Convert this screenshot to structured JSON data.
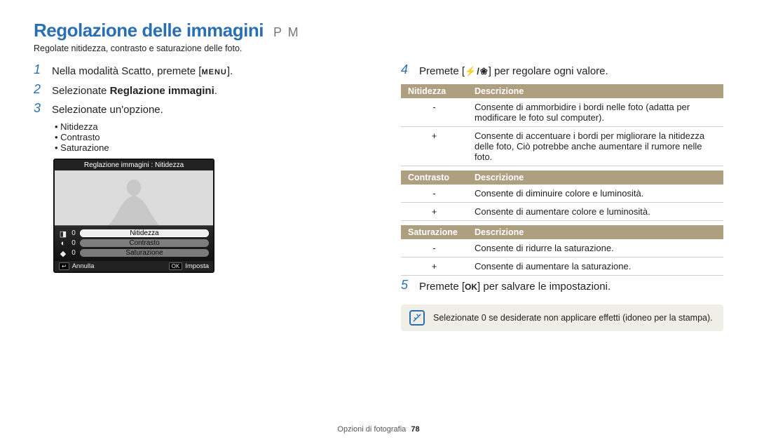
{
  "title": "Regolazione delle immagini",
  "mode_badges": "P M",
  "intro": "Regolate nitidezza, contrasto e saturazione delle foto.",
  "left": {
    "steps": {
      "1": {
        "pre": "Nella modalità Scatto, premete [",
        "icon": "MENU",
        "post": "]."
      },
      "2": {
        "pre": "Selezionate ",
        "bold": "Reglazione immagini",
        "post": "."
      },
      "3": {
        "text": "Selezionate un'opzione.",
        "bullets": [
          "Nitidezza",
          "Contrasto",
          "Saturazione"
        ]
      }
    },
    "camera": {
      "heading": "Reglazione immagini : Nitidezza",
      "rows": [
        {
          "icon": "◨",
          "value": "0",
          "label": "Nitidezza",
          "active": true
        },
        {
          "icon": "◐",
          "value": "0",
          "label": "Contrasto",
          "active": false
        },
        {
          "icon": "◆",
          "value": "0",
          "label": "Saturazione",
          "active": false
        }
      ],
      "back_key": "↩",
      "back_label": "Annulla",
      "ok_key": "OK",
      "ok_label": "Imposta"
    }
  },
  "right": {
    "step4": {
      "pre": "Premete [",
      "icons": "⚡/❀",
      "post": "] per regolare ogni valore."
    },
    "tables": [
      {
        "h1": "Nitidezza",
        "h2": "Descrizione",
        "rows": [
          {
            "sign": "-",
            "desc": "Consente di ammorbidire i bordi nelle foto (adatta per modificare le foto sul computer)."
          },
          {
            "sign": "+",
            "desc": "Consente di accentuare i bordi per migliorare la nitidezza delle foto, Ciò potrebbe anche aumentare il rumore nelle foto."
          }
        ]
      },
      {
        "h1": "Contrasto",
        "h2": "Descrizione",
        "rows": [
          {
            "sign": "-",
            "desc": "Consente di diminuire colore e luminosità."
          },
          {
            "sign": "+",
            "desc": "Consente di aumentare colore e luminosità."
          }
        ]
      },
      {
        "h1": "Saturazione",
        "h2": "Descrizione",
        "rows": [
          {
            "sign": "-",
            "desc": "Consente di ridurre la saturazione."
          },
          {
            "sign": "+",
            "desc": "Consente di aumentare la saturazione."
          }
        ]
      }
    ],
    "step5": {
      "pre": "Premete [",
      "icon": "OK",
      "post": "] per salvare le impostazioni."
    },
    "tip": "Selezionate 0 se desiderate non applicare effetti (idoneo per la stampa)."
  },
  "footer": {
    "section": "Opzioni di fotografia",
    "page": "78"
  }
}
